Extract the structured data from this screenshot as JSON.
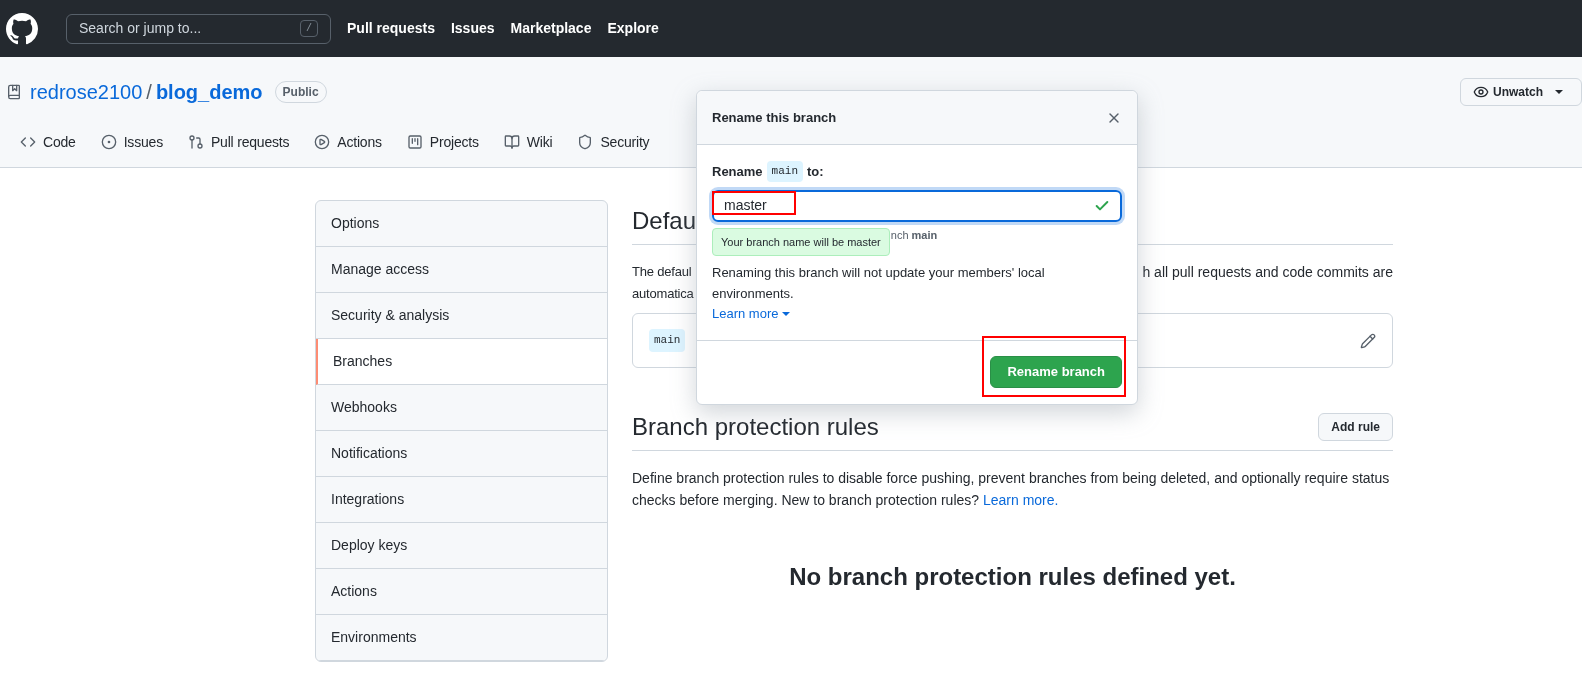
{
  "header": {
    "search": {
      "placeholder": "Search or jump to...",
      "shortcut": "/"
    },
    "nav": [
      "Pull requests",
      "Issues",
      "Marketplace",
      "Explore"
    ]
  },
  "repo": {
    "owner": "redrose2100",
    "separator": "/",
    "name": "blog_demo",
    "visibility": "Public",
    "watch_button": "Unwatch"
  },
  "tabs": [
    {
      "label": "Code",
      "selected": false
    },
    {
      "label": "Issues",
      "selected": false
    },
    {
      "label": "Pull requests",
      "selected": false
    },
    {
      "label": "Actions",
      "selected": false
    },
    {
      "label": "Projects",
      "selected": false
    },
    {
      "label": "Wiki",
      "selected": false
    },
    {
      "label": "Security",
      "selected": false
    }
  ],
  "sidebar": {
    "items": [
      {
        "label": "Options",
        "selected": false
      },
      {
        "label": "Manage access",
        "selected": false
      },
      {
        "label": "Security & analysis",
        "selected": false
      },
      {
        "label": "Branches",
        "selected": true
      },
      {
        "label": "Webhooks",
        "selected": false
      },
      {
        "label": "Notifications",
        "selected": false
      },
      {
        "label": "Integrations",
        "selected": false
      },
      {
        "label": "Deploy keys",
        "selected": false
      },
      {
        "label": "Actions",
        "selected": false
      },
      {
        "label": "Environments",
        "selected": false
      }
    ]
  },
  "default_branch": {
    "heading": "Defau",
    "text_line_1_left": "The defaul",
    "text_line_1_right": "h all pull requests and code commits are",
    "text_line_2": "automatica",
    "branch": "main"
  },
  "protection": {
    "heading": "Branch protection rules",
    "add_button": "Add rule",
    "description": "Define branch protection rules to disable force pushing, prevent branches from being deleted, and optionally require status checks before merging. New to branch protection rules?",
    "learn_more": "Learn more.",
    "empty": "No branch protection rules defined yet."
  },
  "dialog": {
    "title": "Rename this branch",
    "label_before": "Rename",
    "label_branch": "main",
    "label_after": "to:",
    "value": "master",
    "valid": true,
    "tooltip": "Your branch name will be master",
    "hint": "nch **main**",
    "warning": "Renaming this branch will not update your members' local environments.",
    "learn_more": "Learn more",
    "submit": "Rename branch"
  }
}
